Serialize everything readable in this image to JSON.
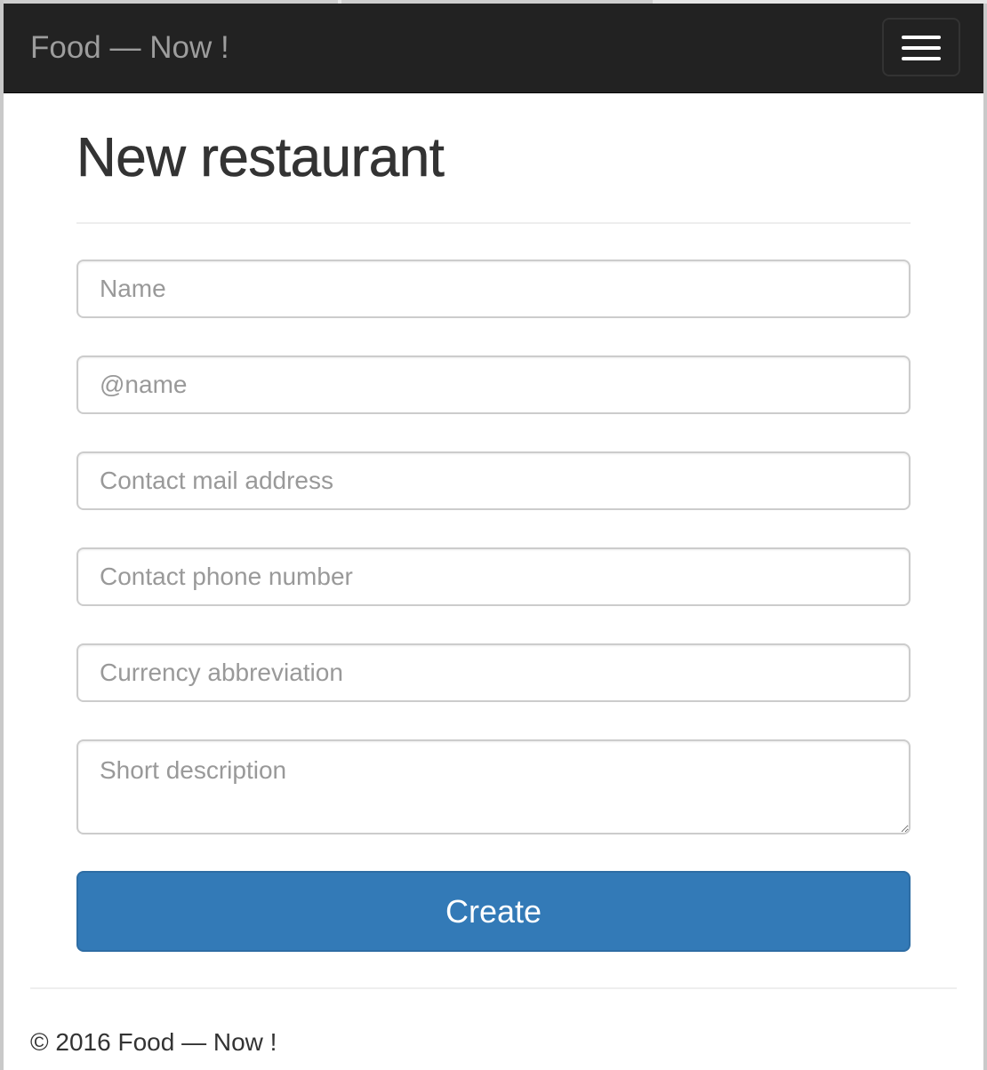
{
  "navbar": {
    "brand": "Food — Now !",
    "toggle_icon": "hamburger-menu-icon"
  },
  "page": {
    "title": "New restaurant"
  },
  "form": {
    "name_placeholder": "Name",
    "handle_placeholder": "@name",
    "email_placeholder": "Contact mail address",
    "phone_placeholder": "Contact phone number",
    "currency_placeholder": "Currency abbreviation",
    "description_placeholder": "Short description",
    "submit_label": "Create"
  },
  "footer": {
    "text": "© 2016 Food — Now !"
  },
  "colors": {
    "navbar_bg": "#222222",
    "brand": "#9d9d9d",
    "primary": "#337ab7",
    "text": "#333333",
    "placeholder": "#999999"
  }
}
